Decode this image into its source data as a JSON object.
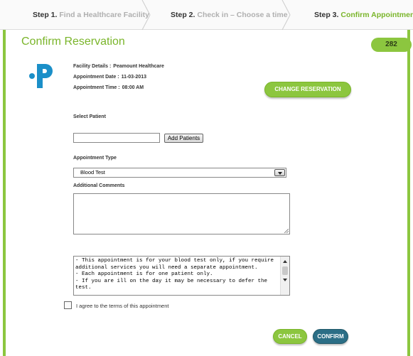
{
  "steps": [
    {
      "num": "Step 1.",
      "label": "Find a Healthcare Facility",
      "active": false
    },
    {
      "num": "Step 2.",
      "label": "Check in – Choose a time",
      "active": false
    },
    {
      "num": "Step 3.",
      "label": "Confirm Appointment",
      "active": true
    }
  ],
  "page_title": "Confirm Reservation",
  "badge_count": "282",
  "details": {
    "facility_label": "Facility Details :",
    "facility_value": "Peamount Healthcare",
    "date_label": "Appointment Date :",
    "date_value": "11-03-2013",
    "time_label": "Appointment Time :",
    "time_value": "08:00 AM"
  },
  "change_button": "CHANGE RESERVATION",
  "select_patient_label": "Select Patient",
  "patient_input_value": "",
  "add_patients_button": "Add Patients",
  "appointment_type_label": "Appointment Type",
  "appointment_type_selected": "Blood Test",
  "comments_label": "Additional Comments",
  "comments_value": "",
  "terms_text": "- This appointment is for your blood test only, if you require additional services you will need a separate appointment.\n- Each appointment is for one patient only.\n- If you are ill on the day it may be necessary to defer the test.",
  "agree_label": "I agree to the terms of this appointment",
  "cancel_button": "CANCEL",
  "confirm_button": "CONFIRM",
  "colors": {
    "accent_green": "#8cc63f",
    "confirm_blue": "#2b6e86",
    "logo_blue": "#1b8fc8"
  }
}
